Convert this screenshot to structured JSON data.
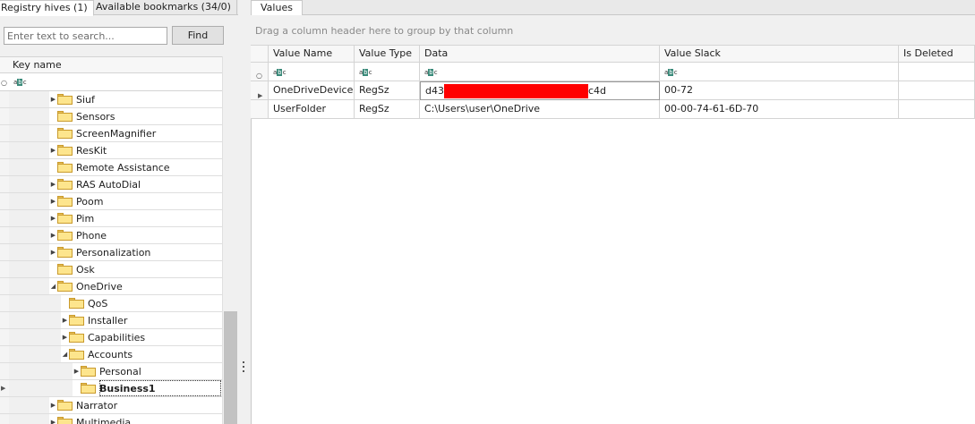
{
  "left_tabs": [
    {
      "label": "Registry hives (1)"
    },
    {
      "label": "Available bookmarks (34/0)"
    }
  ],
  "search": {
    "placeholder": "Enter text to search...",
    "find_label": "Find"
  },
  "tree": {
    "column_header": "Key name",
    "nodes": [
      {
        "label": "Siuf",
        "depth": 0,
        "expandable": true,
        "expanded": false
      },
      {
        "label": "Sensors",
        "depth": 0,
        "expandable": false,
        "expanded": false
      },
      {
        "label": "ScreenMagnifier",
        "depth": 0,
        "expandable": false,
        "expanded": false
      },
      {
        "label": "ResKit",
        "depth": 0,
        "expandable": true,
        "expanded": false
      },
      {
        "label": "Remote Assistance",
        "depth": 0,
        "expandable": false,
        "expanded": false
      },
      {
        "label": "RAS AutoDial",
        "depth": 0,
        "expandable": true,
        "expanded": false
      },
      {
        "label": "Poom",
        "depth": 0,
        "expandable": true,
        "expanded": false
      },
      {
        "label": "Pim",
        "depth": 0,
        "expandable": true,
        "expanded": false
      },
      {
        "label": "Phone",
        "depth": 0,
        "expandable": true,
        "expanded": false
      },
      {
        "label": "Personalization",
        "depth": 0,
        "expandable": true,
        "expanded": false
      },
      {
        "label": "Osk",
        "depth": 0,
        "expandable": false,
        "expanded": false
      },
      {
        "label": "OneDrive",
        "depth": 0,
        "expandable": true,
        "expanded": true
      },
      {
        "label": "QoS",
        "depth": 1,
        "expandable": false,
        "expanded": false
      },
      {
        "label": "Installer",
        "depth": 1,
        "expandable": true,
        "expanded": false
      },
      {
        "label": "Capabilities",
        "depth": 1,
        "expandable": true,
        "expanded": false
      },
      {
        "label": "Accounts",
        "depth": 1,
        "expandable": true,
        "expanded": true
      },
      {
        "label": "Personal",
        "depth": 2,
        "expandable": true,
        "expanded": false
      },
      {
        "label": "Business1",
        "depth": 2,
        "expandable": false,
        "expanded": false,
        "selected": true
      },
      {
        "label": "Narrator",
        "depth": 0,
        "expandable": true,
        "expanded": false
      },
      {
        "label": "Multimedia",
        "depth": 0,
        "expandable": true,
        "expanded": false
      }
    ]
  },
  "right_tabs": [
    {
      "label": "Values"
    }
  ],
  "grid": {
    "group_hint": "Drag a column header here to group by that column",
    "columns": [
      "Value Name",
      "Value Type",
      "Data",
      "Value Slack",
      "Is Deleted"
    ],
    "rows": [
      {
        "value_name": "OneDriveDeviceId",
        "value_type": "RegSz",
        "data_prefix": "d43c",
        "data_suffix": "c4d",
        "value_slack": "00-72",
        "is_deleted": "",
        "redacted": true
      },
      {
        "value_name": "UserFolder",
        "value_type": "RegSz",
        "data_prefix": "C:\\Users\\user\\OneDrive",
        "data_suffix": "",
        "value_slack": "00-00-74-61-6D-70",
        "is_deleted": "",
        "redacted": false
      }
    ]
  },
  "colors": {
    "redaction": "#ff0000",
    "folder": "#fde58d"
  }
}
